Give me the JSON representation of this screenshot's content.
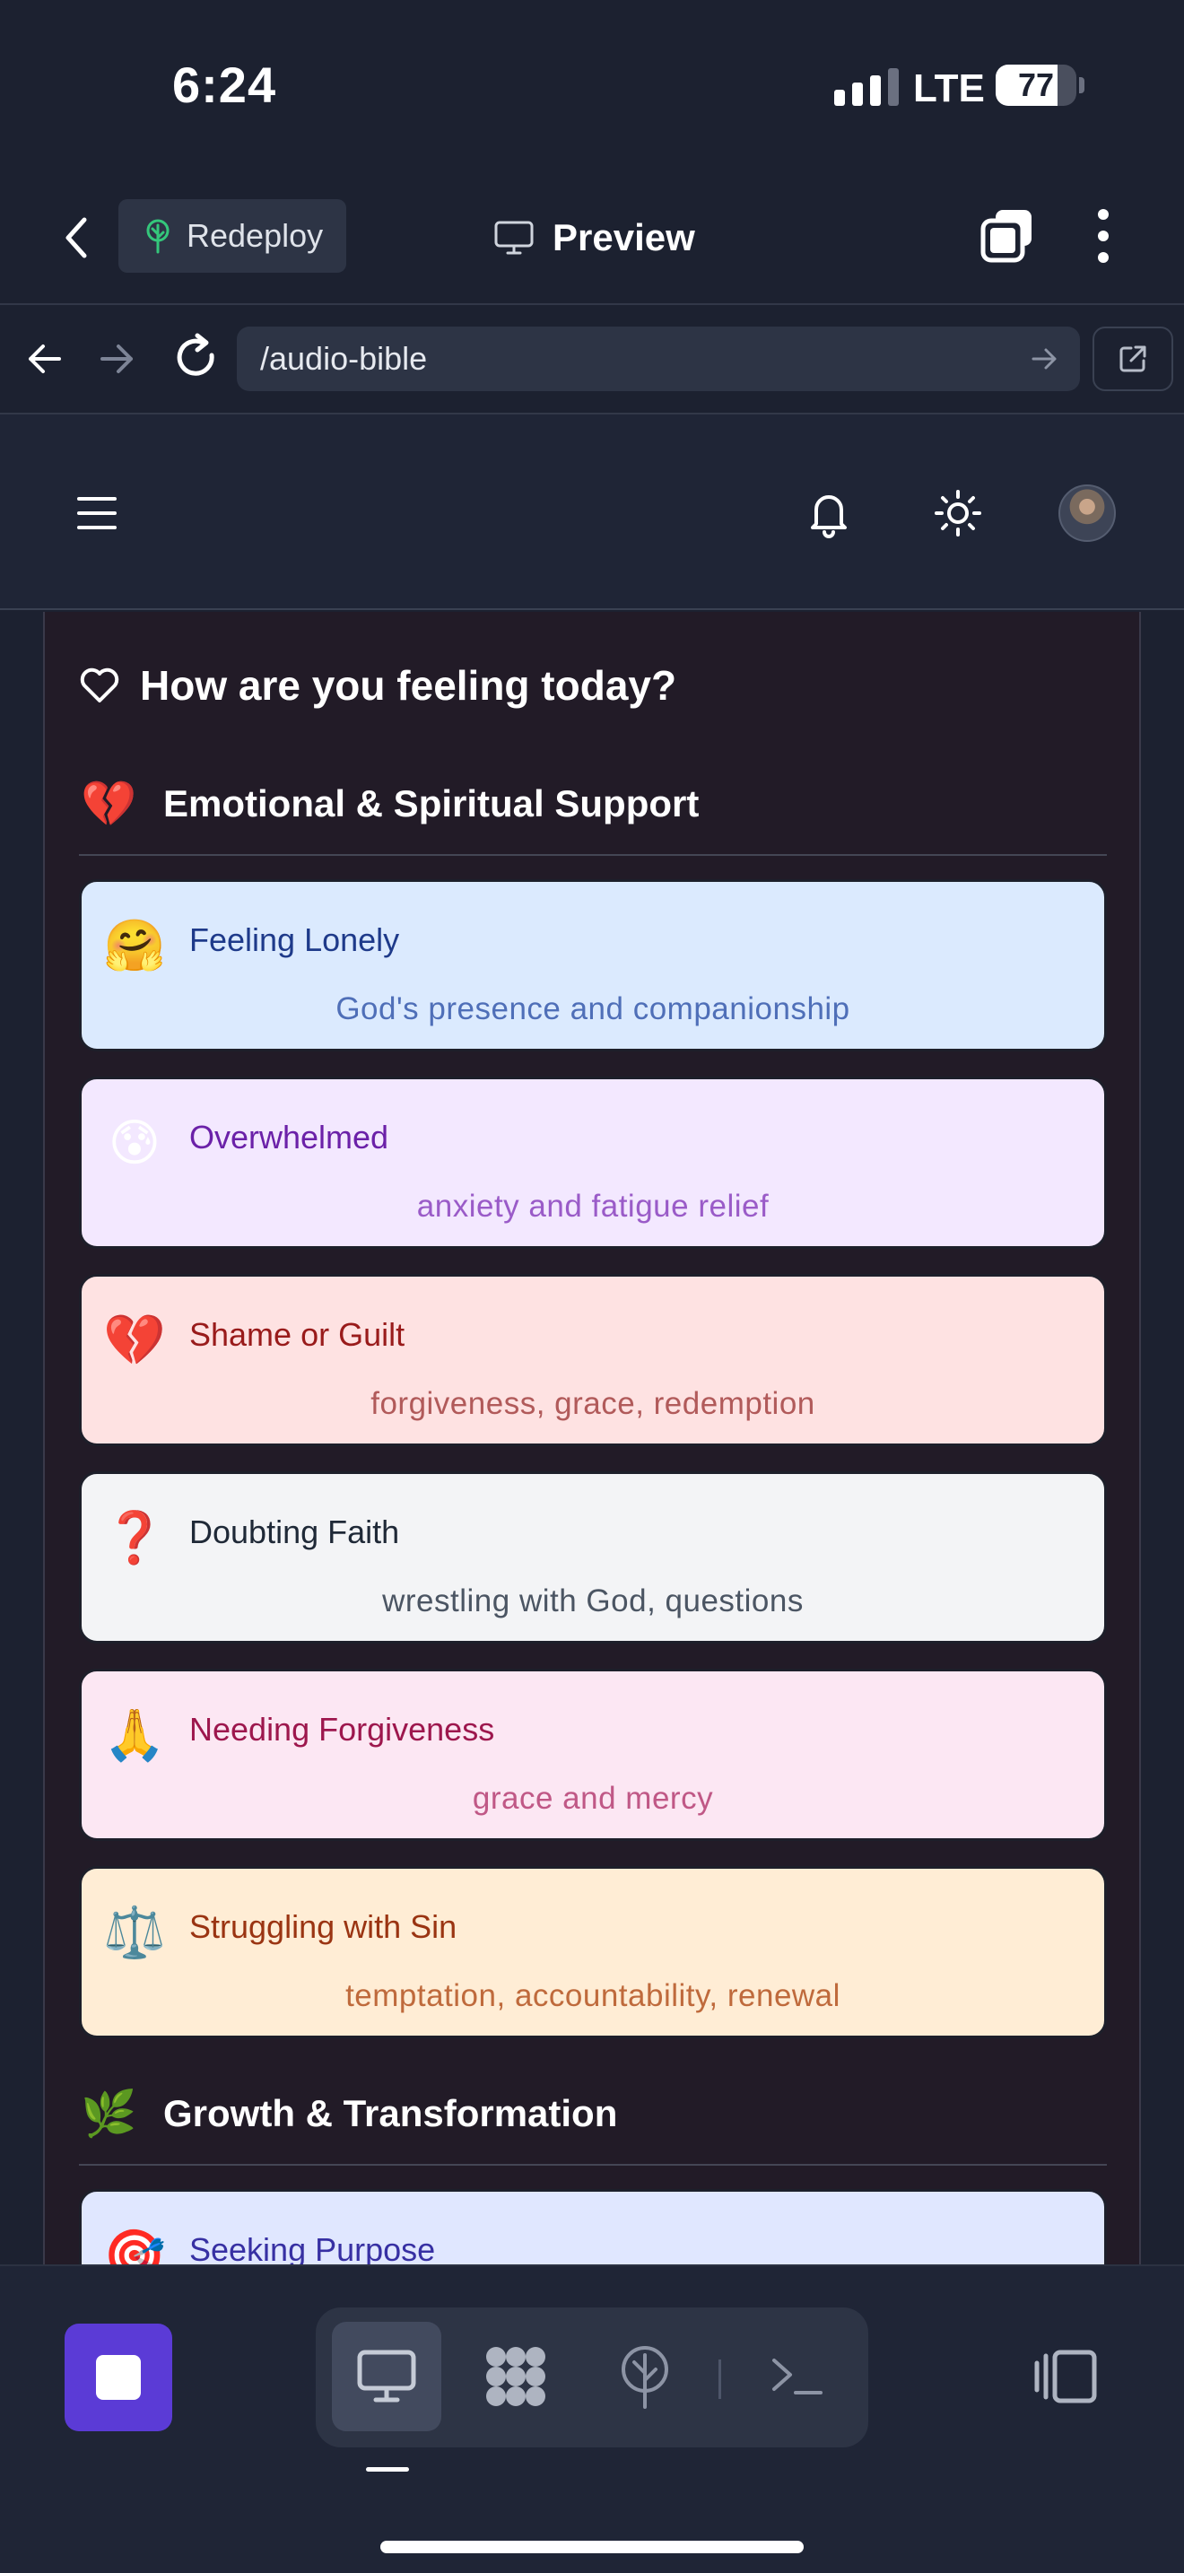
{
  "status_bar": {
    "time": "6:24",
    "network": "LTE",
    "battery": "77"
  },
  "toolbar": {
    "redeploy_label": "Redeploy",
    "preview_label": "Preview"
  },
  "browser": {
    "url": "/audio-bible"
  },
  "page": {
    "heading": "How are you feeling today?"
  },
  "sections": [
    {
      "emoji": "💔",
      "title": "Emotional & Spiritual Support",
      "items": [
        {
          "emoji": "🤗",
          "title": "Feeling Lonely",
          "subtitle": "God's presence and companionship"
        },
        {
          "emoji": "😰",
          "title": "Overwhelmed",
          "subtitle": "anxiety and fatigue relief"
        },
        {
          "emoji": "💔",
          "title": "Shame or Guilt",
          "subtitle": "forgiveness, grace, redemption"
        },
        {
          "emoji": "❓",
          "title": "Doubting Faith",
          "subtitle": "wrestling with God, questions"
        },
        {
          "emoji": "🙏",
          "title": "Needing Forgiveness",
          "subtitle": "grace and mercy"
        },
        {
          "emoji": "⚖️",
          "title": "Struggling with Sin",
          "subtitle": "temptation, accountability, renewal"
        }
      ]
    },
    {
      "emoji": "🌿",
      "title": "Growth & Transformation",
      "items": [
        {
          "emoji": "🎯",
          "title": "Seeking Purpose",
          "subtitle": ""
        }
      ]
    }
  ],
  "colors": {
    "lonely": {
      "bg": "#dbeafe",
      "title": "#1e3a8a",
      "subtitle": "#4f6fb8"
    },
    "overwhelmed": {
      "bg": "#f3e8ff",
      "title": "#6b21a8",
      "subtitle": "#9a5bc8"
    },
    "shame": {
      "bg": "#fee2e2",
      "title": "#991b1b",
      "subtitle": "#b15a5a"
    },
    "doubting": {
      "bg": "#f3f4f6",
      "title": "#1f2937",
      "subtitle": "#4b5563"
    },
    "forgiveness": {
      "bg": "#fce7f3",
      "title": "#9d174d",
      "subtitle": "#c05886"
    },
    "sin": {
      "bg": "#ffedd5",
      "title": "#9a3412",
      "subtitle": "#bf6a3c"
    },
    "purpose": {
      "bg": "#e0e7ff",
      "title": "#3730a3",
      "subtitle": "#5b5fb8"
    },
    "accent": "#5b3bd6"
  },
  "icons": {
    "back": "chevron-left-icon",
    "redeploy": "deploy-tree-icon",
    "preview": "monitor-icon",
    "tabs": "tabs-icon",
    "more": "kebab-menu-icon",
    "nav_back": "arrow-left-icon",
    "nav_forward": "arrow-right-icon",
    "reload": "reload-icon",
    "open_external": "external-link-icon",
    "menu": "hamburger-icon",
    "notifications": "bell-icon",
    "theme": "sun-icon",
    "heading": "heart-icon",
    "stop": "stop-icon",
    "tool_preview": "monitor-icon",
    "tool_apps": "apps-icon",
    "tool_deploy": "deploy-icon",
    "tool_shell": "terminal-icon",
    "split_view": "split-view-icon"
  }
}
